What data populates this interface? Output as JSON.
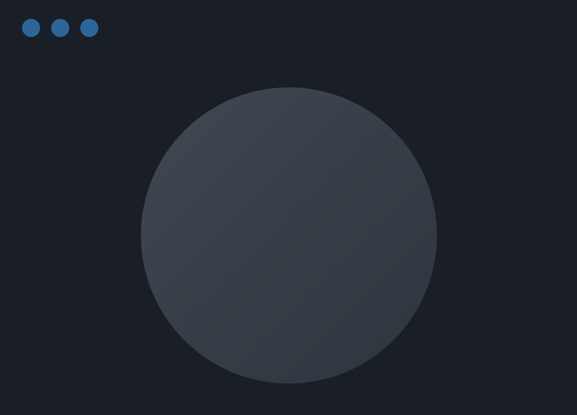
{
  "window": {
    "background_color": "#1a1e27",
    "dots": {
      "color": "#2c6699",
      "items": [
        {
          "icon": "dot-icon"
        },
        {
          "icon": "dot-icon"
        },
        {
          "icon": "dot-icon"
        }
      ]
    },
    "center_circle": {
      "icon": "circle-placeholder-icon",
      "colors": [
        "#424953",
        "#393f48",
        "#2e343d"
      ]
    }
  }
}
